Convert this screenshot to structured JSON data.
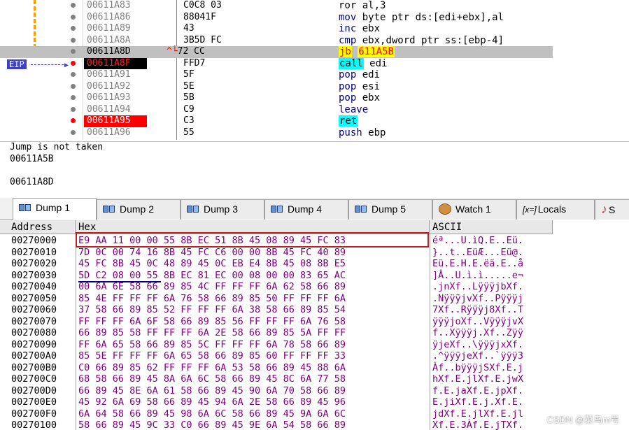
{
  "disassembly": {
    "eip_label": "EIP",
    "rows": [
      {
        "addr": "00611A83",
        "bytes": "C0C8 03",
        "mnem": "ror",
        "ops": "al,3",
        "addr_style": "normal",
        "bp": "gray"
      },
      {
        "addr": "00611A86",
        "bytes": "88041F",
        "mnem": "mov",
        "ops": "byte ptr ds:[edi+ebx],al",
        "addr_style": "normal",
        "bp": "gray"
      },
      {
        "addr": "00611A89",
        "bytes": "43",
        "mnem": "inc",
        "ops": "ebx",
        "addr_style": "normal",
        "bp": "gray"
      },
      {
        "addr": "00611A8A",
        "bytes": "3B5D FC",
        "mnem": "cmp",
        "ops": "ebx,dword ptr ss:[ebp-4]",
        "addr_style": "normal",
        "bp": "gray"
      },
      {
        "addr": "00611A8D",
        "bytes": "72 CC",
        "mnem": "jb",
        "ops": "611A5B",
        "addr_style": "selected",
        "bp": "gray",
        "jump_mark": "^└"
      },
      {
        "addr": "00611A8F",
        "bytes": "FFD7",
        "mnem": "call",
        "ops": "edi",
        "addr_style": "eip",
        "bp": "red"
      },
      {
        "addr": "00611A91",
        "bytes": "5F",
        "mnem": "pop",
        "ops": "edi",
        "addr_style": "normal",
        "bp": "gray"
      },
      {
        "addr": "00611A92",
        "bytes": "5E",
        "mnem": "pop",
        "ops": "esi",
        "addr_style": "normal",
        "bp": "gray"
      },
      {
        "addr": "00611A93",
        "bytes": "5B",
        "mnem": "pop",
        "ops": "ebx",
        "addr_style": "normal",
        "bp": "gray"
      },
      {
        "addr": "00611A94",
        "bytes": "C9",
        "mnem": "leave",
        "ops": "",
        "addr_style": "normal",
        "bp": "gray"
      },
      {
        "addr": "00611A95",
        "bytes": "C3",
        "mnem": "ret",
        "ops": "",
        "addr_style": "breakpoint",
        "bp": "red"
      },
      {
        "addr": "00611A96",
        "bytes": "55",
        "mnem": "push",
        "ops": "ebp",
        "addr_style": "normal",
        "bp": "gray"
      }
    ]
  },
  "info": {
    "line1": "Jump is not taken",
    "line2": "00611A5B",
    "line3": "00611A8D"
  },
  "tabs": [
    {
      "label": "Dump 1",
      "icon": "memory-icon",
      "active": true
    },
    {
      "label": "Dump 2",
      "icon": "memory-icon",
      "active": false
    },
    {
      "label": "Dump 3",
      "icon": "memory-icon",
      "active": false
    },
    {
      "label": "Dump 4",
      "icon": "memory-icon",
      "active": false
    },
    {
      "label": "Dump 5",
      "icon": "memory-icon",
      "active": false
    },
    {
      "label": "Watch 1",
      "icon": "watch-icon",
      "active": false
    },
    {
      "label": "Locals",
      "icon": "locals-icon",
      "icon_text": "[x=]",
      "active": false
    },
    {
      "label": "S",
      "icon": "struct-icon",
      "active": false
    }
  ],
  "dump": {
    "headers": {
      "address": "Address",
      "hex": "Hex",
      "ascii": "ASCII"
    },
    "rows": [
      {
        "addr": "00270000",
        "hex": "E9 AA 11 00 00 55 8B EC 51 8B 45 08 89 45 FC 83",
        "ascii": "éª...U.ìQ.E..Eü."
      },
      {
        "addr": "00270010",
        "hex": "7D 0C 00 74 16 8B 45 FC C6 00 00 8B 45 FC 40 89",
        "ascii": "}..t..EüÆ...Eü@."
      },
      {
        "addr": "00270020",
        "hex": "45 FC 8B 45 0C 48 89 45 0C EB E4 8B 45 08 8B E5",
        "ascii": "Eü.E.H.E.ëä.E..å"
      },
      {
        "addr": "00270030",
        "hex": "5D C2 08 00 55 8B EC 81 EC 00 08 00 00 83 65 AC",
        "ascii": "]Â..U.ì.ì.....e¬"
      },
      {
        "addr": "00270040",
        "hex": "00 6A 6E 58 66 89 85 4C FF FF FF 6A 62 58 66 89",
        "ascii": ".jnXf..LÿÿÿjbXf."
      },
      {
        "addr": "00270050",
        "hex": "85 4E FF FF FF 6A 76 58 66 89 85 50 FF FF FF 6A",
        "ascii": ".NÿÿÿjvXf..Pÿÿÿj"
      },
      {
        "addr": "00270060",
        "hex": "37 58 66 89 85 52 FF FF FF 6A 38 58 66 89 85 54",
        "ascii": "7Xf..Rÿÿÿj8Xf..T"
      },
      {
        "addr": "00270070",
        "hex": "FF FF FF 6A 6F 58 66 89 85 56 FF FF FF 6A 76 58",
        "ascii": "ÿÿÿjoXf..VÿÿÿjvX"
      },
      {
        "addr": "00270080",
        "hex": "66 89 85 58 FF FF FF 6A 2E 58 66 89 85 5A FF FF",
        "ascii": "f..Xÿÿÿj.Xf..Zÿÿ"
      },
      {
        "addr": "00270090",
        "hex": "FF 6A 65 58 66 89 85 5C FF FF FF 6A 78 58 66 89",
        "ascii": "ÿjeXf..\\ÿÿÿjxXf."
      },
      {
        "addr": "002700A0",
        "hex": "85 5E FF FF FF 6A 65 58 66 89 85 60 FF FF FF 33",
        "ascii": ".^ÿÿÿjeXf..`ÿÿÿ3"
      },
      {
        "addr": "002700B0",
        "hex": "C0 66 89 85 62 FF FF FF 6A 53 58 66 89 45 88 6A",
        "ascii": "Àf..bÿÿÿjSXf.E.j"
      },
      {
        "addr": "002700C0",
        "hex": "68 58 66 89 45 8A 6A 6C 58 66 89 45 8C 6A 77 58",
        "ascii": "hXf.E.jlXf.E.jwX"
      },
      {
        "addr": "002700D0",
        "hex": "66 89 45 8E 6A 61 58 66 89 45 90 6A 70 58 66 89",
        "ascii": "f.E.jaXf.E.jpXf."
      },
      {
        "addr": "002700E0",
        "hex": "45 92 6A 69 58 66 89 45 94 6A 2E 58 66 89 45 96",
        "ascii": "E.jiXf.E.j.Xf.E."
      },
      {
        "addr": "002700F0",
        "hex": "6A 64 58 66 89 45 98 6A 6C 58 66 89 45 9A 6A 6C",
        "ascii": "jdXf.E.jlXf.E.jl"
      },
      {
        "addr": "00270100",
        "hex": "58 66 89 45 9C 33 C0 66 89 45 9E 6A 54 58 66 89",
        "ascii": "Xf.E.3Àf.E.jTXf."
      }
    ]
  },
  "watermark": "CSDN @菜鸟m号"
}
